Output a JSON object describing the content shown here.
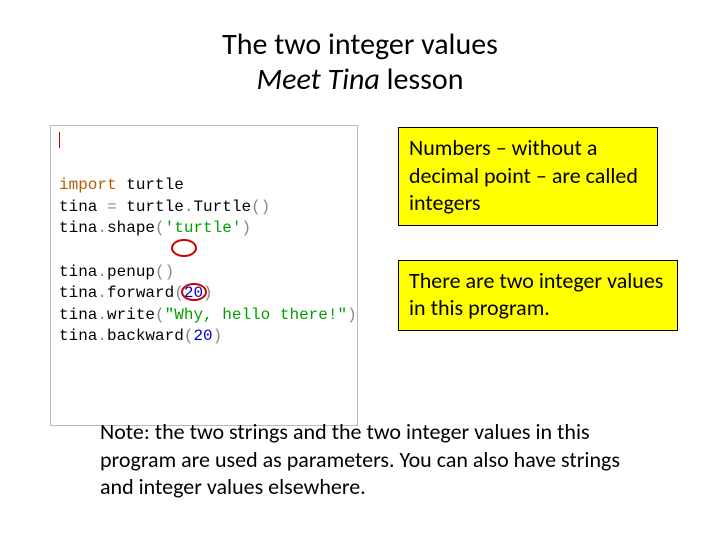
{
  "title": {
    "line1": "The two integer values",
    "line2_italic": "Meet Tina",
    "line2_rest": " lesson"
  },
  "code": {
    "l1_kw": "import",
    "l1_sp": " ",
    "l1_mod": "turtle",
    "l2_a": "tina ",
    "l2_eq": "=",
    "l2_b": " turtle",
    "l2_dot": ".",
    "l2_c": "Turtle",
    "l2_p": "()",
    "l3_a": "tina",
    "l3_dot": ".",
    "l3_b": "shape",
    "l3_po": "(",
    "l3_s": "'turtle'",
    "l3_pc": ")",
    "l5_a": "tina",
    "l5_dot": ".",
    "l5_b": "penup",
    "l5_p": "()",
    "l6_a": "tina",
    "l6_dot": ".",
    "l6_b": "forward",
    "l6_po": "(",
    "l6_n": "20",
    "l6_pc": ")",
    "l7_a": "tina",
    "l7_dot": ".",
    "l7_b": "write",
    "l7_po": "(",
    "l7_s": "\"Why, hello there!\"",
    "l7_pc": ")",
    "l8_a": "tina",
    "l8_dot": ".",
    "l8_b": "backward",
    "l8_po": "(",
    "l8_n": "20",
    "l8_pc": ")"
  },
  "callouts": {
    "c1": "Numbers – without a decimal point – are called integers",
    "c2": "There are two integer values in this program."
  },
  "note": "Note: the two strings and the two integer values in this program are used as parameters.  You can also have strings and integer values elsewhere."
}
